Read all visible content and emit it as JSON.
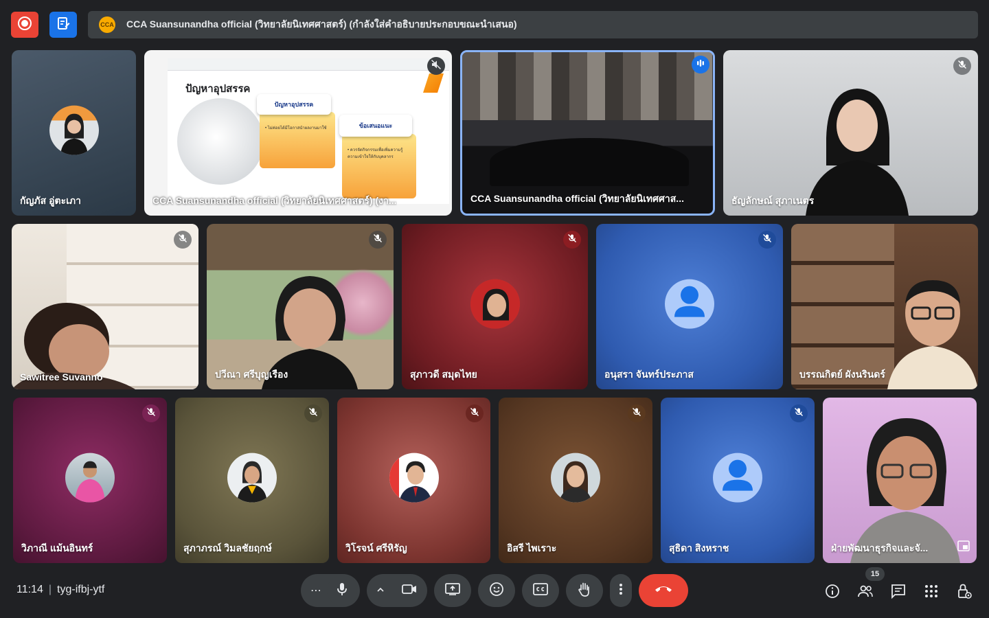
{
  "header": {
    "badge": "CCA",
    "presentation_title": "CCA Suansunandha official (วิทยาลัยนิเทศศาสตร์) (กำลังใส่คำอธิบายประกอบขณะนำเสนอ)"
  },
  "slide": {
    "title": "ปัญหาอุปสรรค",
    "card1_title": "ปัญหาอุปสรรค",
    "card1_bullet": "• ไม่ค่อยได้มีโอกาสนำผลงานมาใช้",
    "card2_title": "ข้อเสนอแนะ",
    "card2_bullet": "• ควรจัดกิจกรรมเพื่อเพิ่มความรู้ ความเข้าใจให้กับบุคลากร"
  },
  "tiles": [
    {
      "name": "กัญภัส อู่ตะเภา",
      "muted": false
    },
    {
      "name": "CCA Suansunandha official (วิทยาลัยนิเทศศาสตร์) (งา...",
      "muted": true
    },
    {
      "name": "CCA Suansunandha official (วิทยาลัยนิเทศศาส...",
      "muted": false,
      "speaking": true
    },
    {
      "name": "ธัญลักษณ์ สุภาเนตร",
      "muted": true
    },
    {
      "name": "Sawitree Suvanno",
      "muted": true
    },
    {
      "name": "ปวีณา ศรีบุญเรือง",
      "muted": true
    },
    {
      "name": "สุภาวดี สมุดไทย",
      "muted": true
    },
    {
      "name": "อนุสรา จันทร์ประภาส",
      "muted": true
    },
    {
      "name": "บรรณกิตย์ ผังนรินดร์",
      "muted": false
    },
    {
      "name": "วิภาณี แม้นอินทร์",
      "muted": true
    },
    {
      "name": "สุภาภรณ์ วิมลชัยฤกษ์",
      "muted": true
    },
    {
      "name": "วิโรจน์ ศรีหิรัญ",
      "muted": true
    },
    {
      "name": "อิสรี ไพเราะ",
      "muted": true
    },
    {
      "name": "สุธิดา สิงหราช",
      "muted": true
    },
    {
      "name": "ฝ่ายพัฒนาธุรกิจและจั...",
      "muted": false
    }
  ],
  "footer": {
    "time": "11:14",
    "meeting_code": "tyg-ifbj-ytf",
    "participant_count": "15"
  },
  "colors": {
    "background": "#202124",
    "control": "#3c4043",
    "end_call": "#ea4335",
    "speaking_border": "#8ab4f8"
  }
}
